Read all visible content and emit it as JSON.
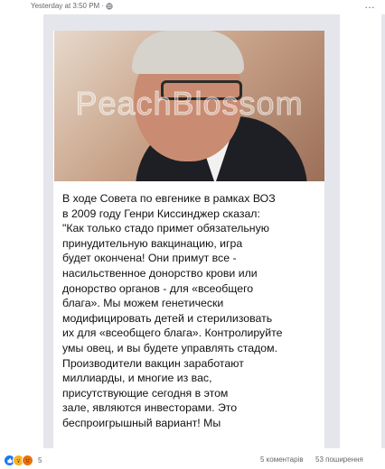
{
  "post": {
    "timestamp": "Yesterday at 3:50 PM ·",
    "privacy_icon": "globe-icon",
    "more_icon": "…"
  },
  "image": {
    "watermark": "PeachBlossom",
    "caption": "В ходе Совета по евгенике в рамках ВОЗ\nв 2009 году Генри Киссинджер сказал:\n\"Как только стадо примет обязательную\nпринудительную вакцинацию, игра\nбудет окончена! Они примут все -\nнасильственное донорство крови или\nдонорство органов - для «всеобщего\nблага». Мы можем генетически\nмодифицировать детей и стерилизовать\nих для «всеобщего блага». Контролируйте\nумы овец, и вы будете управлять стадом.\nПроизводители вакцин заработают\nмиллиарды, и многие из вас,\nприсутствующие сегодня в этом\nзале, являются инвесторами. Это\nбеспроигрышный вариант! Мы"
  },
  "footer": {
    "reactions": [
      "like-icon",
      "wow-icon",
      "angry-icon"
    ],
    "reaction_count": "5",
    "comments": "5 коментарів",
    "shares": "53 поширення"
  },
  "colors": {
    "like": "#1877f2",
    "wow": "#f7b125",
    "angry": "#e9710f",
    "meta_text": "#65676b"
  }
}
